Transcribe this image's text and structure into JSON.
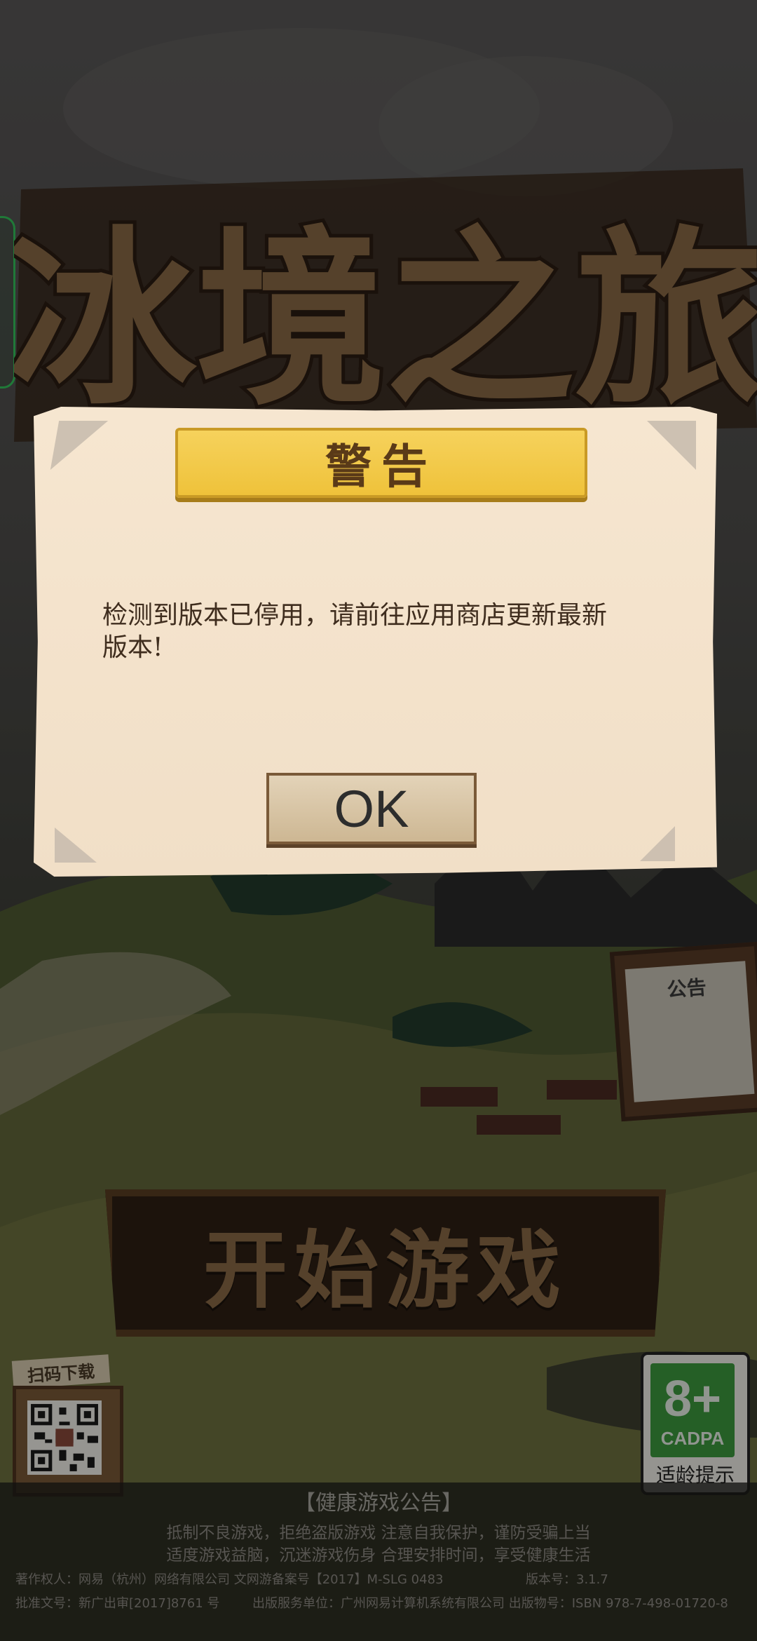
{
  "game": {
    "logo_text": "冰境之旅",
    "start_button": "开始游戏",
    "notice_board_title": "公告",
    "qr_label": "扫码下载"
  },
  "dialog": {
    "title": "警告",
    "message_line1": "检测到版本已停用，请前往应用商店更新最新",
    "message_line2": "版本!",
    "ok_label": "OK"
  },
  "age_rating": {
    "age": "8+",
    "org": "CADPA",
    "label": "适龄提示"
  },
  "footer": {
    "title": "【健康游戏公告】",
    "line1": "抵制不良游戏，拒绝盗版游戏 注意自我保护，谨防受骗上当",
    "line2": "适度游戏益脑，沉迷游戏伤身 合理安排时间，享受健康生活",
    "copyright": "著作权人：网易（杭州）网络有限公司 文网游备案号【2017】M-SLG 0483",
    "version": "版本号：3.1.7",
    "approval": "批准文号：新广出审[2017]8761 号",
    "publisher": "出版服务单位：广州网易计算机系统有限公司 出版物号：ISBN 978-7-498-01720-8"
  },
  "colors": {
    "banner": "#efc23a",
    "dialog_bg": "#f3e2cb",
    "age_green": "#3c9a3e",
    "side_tab_border": "#35c45b"
  }
}
